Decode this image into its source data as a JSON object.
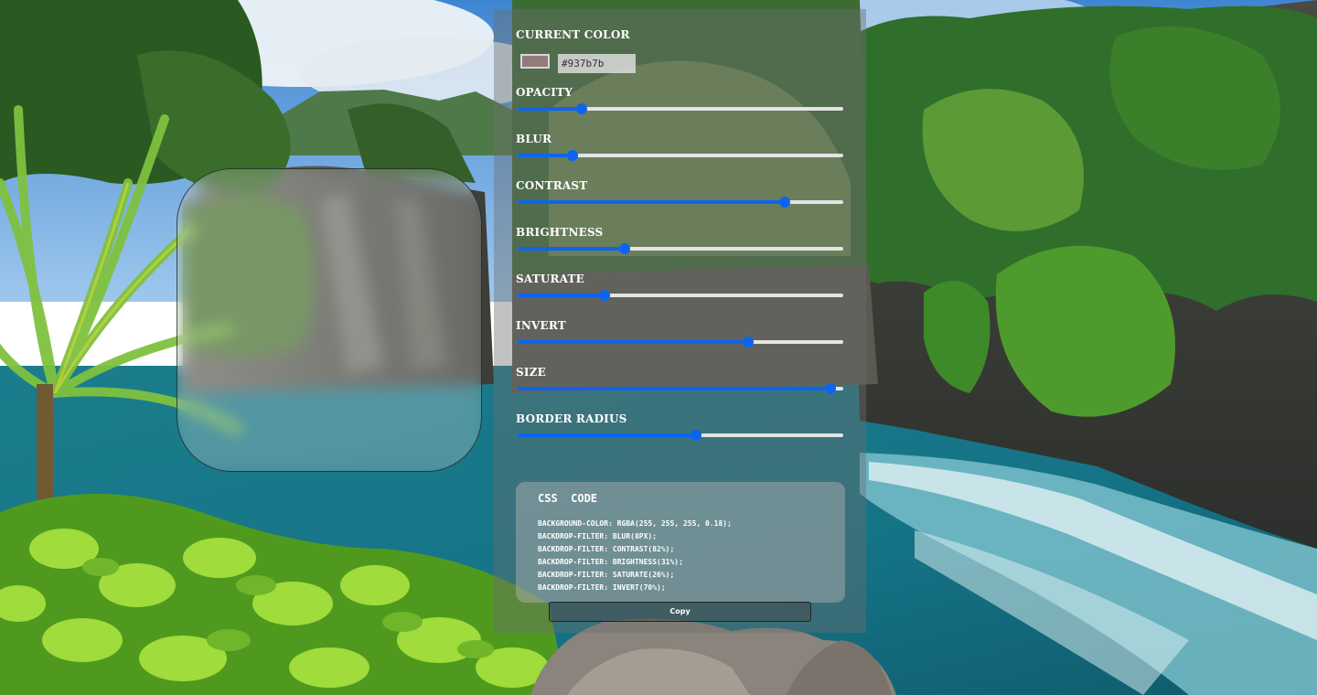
{
  "panel": {
    "current_color_label": "CURRENT COLOR",
    "color_hex": "#937b7b",
    "sliders": [
      {
        "label": "OPACITY",
        "value": 0.2
      },
      {
        "label": "BLUR",
        "value": 0.17
      },
      {
        "label": "CONTRAST",
        "value": 0.82
      },
      {
        "label": "BRIGHTNESS",
        "value": 0.33
      },
      {
        "label": "SATURATE",
        "value": 0.27
      },
      {
        "label": "INVERT",
        "value": 0.71
      },
      {
        "label": "SIZE",
        "value": 0.96
      },
      {
        "label": "BORDER RADIUS",
        "value": 0.55
      }
    ]
  },
  "code": {
    "title": "CSS  CODE",
    "lines": [
      "BACKGROUND-COLOR: RGBA(255, 255, 255, 0.18);",
      "BACKDROP-FILTER: BLUR(8PX);",
      "BACKDROP-FILTER: CONTRAST(82%);",
      "BACKDROP-FILTER: BRIGHTNESS(31%);",
      "BACKDROP-FILTER: SATURATE(26%);",
      "BACKDROP-FILTER: INVERT(70%);"
    ]
  },
  "copy_label": "Copy",
  "colors": {
    "accent": "#0d64f0",
    "track": "#e4e4e4",
    "swatch": "#937b7b"
  }
}
